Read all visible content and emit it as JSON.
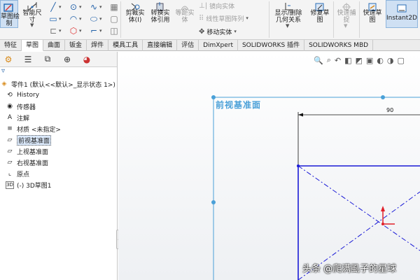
{
  "ribbon": {
    "sketch_label_l1": "草图绘",
    "sketch_label_l2": "制",
    "smart_dim_l1": "智能尺",
    "smart_dim_l2": "寸",
    "trim_l1": "剪裁实",
    "trim_l2": "体(I)",
    "convert_l1": "转换实",
    "convert_l2": "体引用",
    "offset_l1": "等距实",
    "offset_l2": "体",
    "mirror": "镜向实体",
    "linear_pattern": "线性草图阵列",
    "move": "移动实体",
    "relations_l1": "显示/删除",
    "relations_l2": "几何关系",
    "repair_l1": "修复草",
    "repair_l2": "图",
    "quick_snap_l1": "快速捕",
    "quick_snap_l2": "捉",
    "rapid_l1": "快速草",
    "rapid_l2": "图",
    "instant2d": "Instant2D"
  },
  "tabs": [
    {
      "label": "特征",
      "active": false
    },
    {
      "label": "草图",
      "active": true
    },
    {
      "label": "曲面",
      "active": false
    },
    {
      "label": "钣金",
      "active": false
    },
    {
      "label": "焊件",
      "active": false
    },
    {
      "label": "模具工具",
      "active": false
    },
    {
      "label": "直接编辑",
      "active": false
    },
    {
      "label": "评估",
      "active": false
    },
    {
      "label": "DimXpert",
      "active": false
    },
    {
      "label": "SOLIDWORKS 插件",
      "active": false
    },
    {
      "label": "SOLIDWORKS MBD",
      "active": false
    }
  ],
  "tree": {
    "root": "零件1 (默认<<默认>_显示状态 1>)",
    "items": [
      {
        "label": "History",
        "icon": "history-icon"
      },
      {
        "label": "传感器",
        "icon": "sensor-icon"
      },
      {
        "label": "注解",
        "icon": "annotation-icon"
      },
      {
        "label": "材质 <未指定>",
        "icon": "material-icon"
      },
      {
        "label": "前视基准面",
        "icon": "plane-icon",
        "selected": true
      },
      {
        "label": "上视基准面",
        "icon": "plane-icon"
      },
      {
        "label": "右视基准面",
        "icon": "plane-icon"
      },
      {
        "label": "原点",
        "icon": "origin-icon"
      },
      {
        "label": "(-) 3D草图1",
        "icon": "3dsketch-icon"
      }
    ]
  },
  "viewport": {
    "plane_label": "前视基准面",
    "dimension_value": "90",
    "sketch_color": "#1a1ad6",
    "plane_color": "#4aa0d8",
    "origin_color": "#e0202a"
  },
  "watermark": "头条 @爬满虱子的星球"
}
